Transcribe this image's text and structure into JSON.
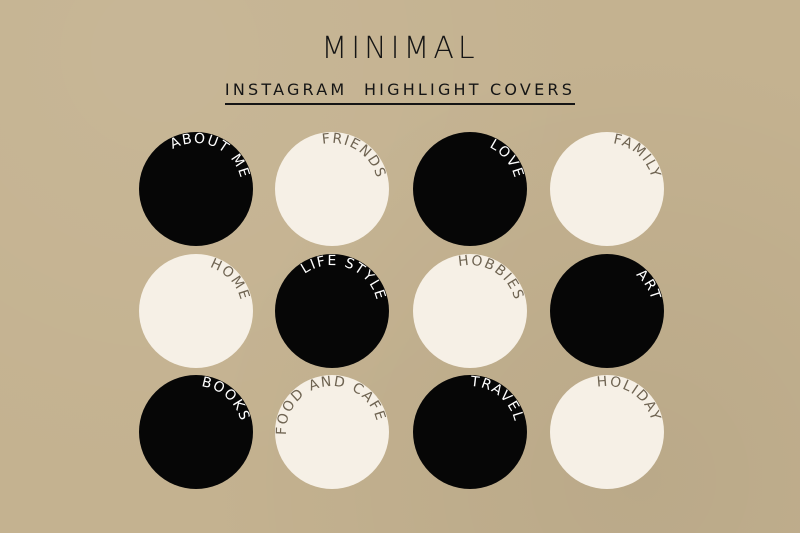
{
  "header": {
    "title": "MINIMAL",
    "subtitle": "INSTAGRAM  HIGHLIGHT COVERS"
  },
  "colors": {
    "background": "#c4b290",
    "dark_circle": "#060606",
    "light_circle": "#f6f0e6",
    "dark_text": "#151515",
    "light_text": "#ffffff",
    "light_circle_text": "#6f6452"
  },
  "covers": [
    {
      "label": "ABOUT ME",
      "style": "dark"
    },
    {
      "label": "FRIENDS",
      "style": "light"
    },
    {
      "label": "LOVE",
      "style": "dark"
    },
    {
      "label": "FAMILY",
      "style": "light"
    },
    {
      "label": "HOME",
      "style": "light"
    },
    {
      "label": "LIFE STYLE",
      "style": "dark"
    },
    {
      "label": "HOBBIES",
      "style": "light"
    },
    {
      "label": "ART",
      "style": "dark"
    },
    {
      "label": "BOOKS",
      "style": "dark"
    },
    {
      "label": "FOOD AND CAFE",
      "style": "light"
    },
    {
      "label": "TRAVEL",
      "style": "dark"
    },
    {
      "label": "HOLIDAY",
      "style": "light"
    }
  ]
}
